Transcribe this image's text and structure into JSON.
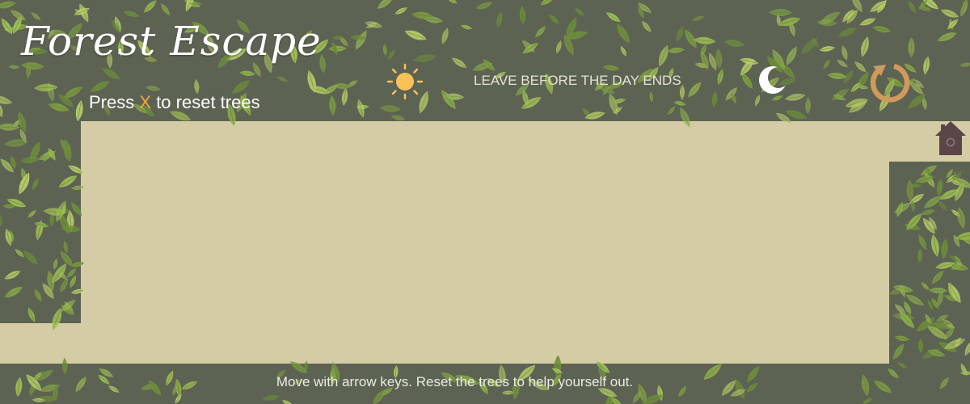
{
  "game": {
    "title": "Forest Escape",
    "hint_prefix": "Press",
    "hint_key": "X",
    "hint_suffix": "to reset trees",
    "status_text": "LEAVE BEFORE THE DAY ENDS",
    "instructions": "Move with arrow keys. Reset the trees to help yourself out."
  },
  "icons": {
    "time_start": "sun-icon",
    "time_end": "moon-icon",
    "reset": "reset-icon",
    "goal": "house-icon"
  },
  "colors": {
    "background": "#5d6353",
    "path": "#d4cca5",
    "leaf_light": "#a3c257",
    "leaf_dark": "#6f8f3a",
    "accent_key": "#f4a640",
    "sun": "#f8c257",
    "reset_icon": "#d09a5c",
    "house": "#5a4548"
  }
}
